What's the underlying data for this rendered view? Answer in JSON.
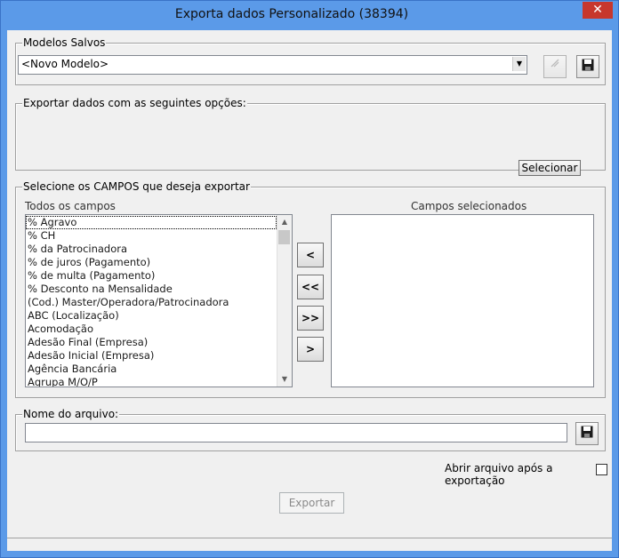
{
  "window": {
    "title": "Exporta dados Personalizado (38394)",
    "close_glyph": "✕"
  },
  "modelos": {
    "group_label": "Modelos Salvos",
    "selected": "<Novo Modelo>",
    "delete_icon": "x-delete-icon",
    "save_icon": "floppy-save-icon"
  },
  "opcoes": {
    "group_label": "Exportar dados com as seguintes opções:",
    "select_button": "Selecionar"
  },
  "campos": {
    "group_label": "Selecione os CAMPOS que deseja exportar",
    "all_label": "Todos os campos",
    "selected_label": "Campos selecionados",
    "all_items": [
      "% Agravo",
      "% CH",
      "% da Patrocinadora",
      "% de juros (Pagamento)",
      "% de multa (Pagamento)",
      "% Desconto na Mensalidade",
      "(Cod.) Master/Operadora/Patrocinadora",
      "ABC (Localização)",
      "Acomodação",
      "Adesão Final (Empresa)",
      "Adesão Inicial (Empresa)",
      "Agência Bancária",
      "Agrupa M/O/P"
    ],
    "btn_remove": "<",
    "btn_remove_all": "<<",
    "btn_add_all": ">>",
    "btn_add": ">"
  },
  "arquivo": {
    "group_label": "Nome do arquivo:",
    "value": ""
  },
  "abrir_label": "Abrir arquivo após a exportação",
  "abrir_checked": false,
  "exportar_label": "Exportar",
  "colors": {
    "titlebar": "#5b9ae8",
    "close": "#c7372d",
    "client": "#f0f0f0"
  }
}
